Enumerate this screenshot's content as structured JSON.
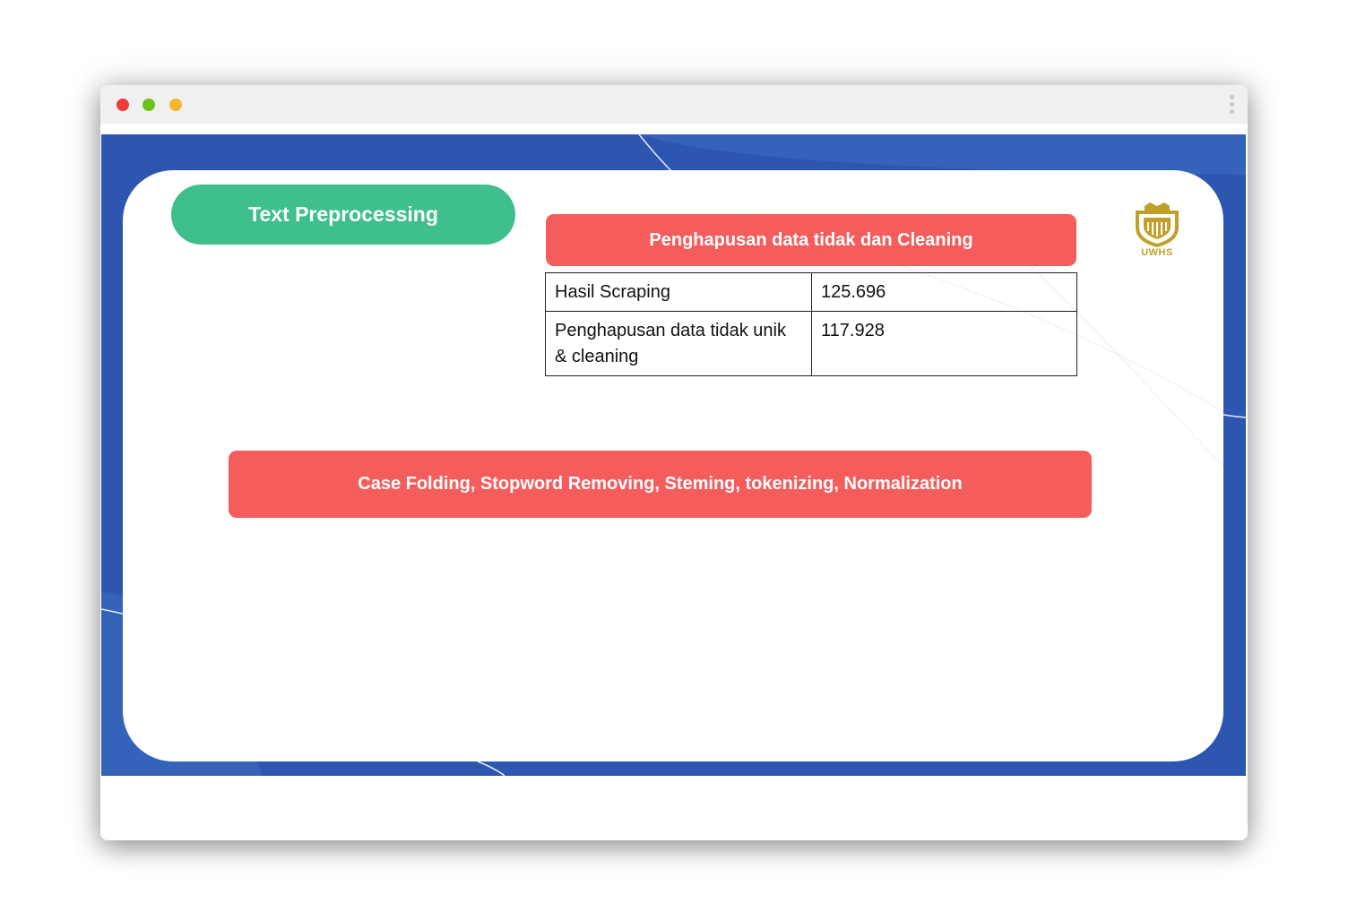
{
  "slide": {
    "title": "Text Preprocessing",
    "section_banner": "Penghapusan data tidak  dan Cleaning",
    "table": {
      "rows": [
        {
          "label": "Hasil Scraping",
          "value": "125.696"
        },
        {
          "label": "Penghapusan data tidak unik & cleaning",
          "value": "117.928"
        }
      ]
    },
    "steps_banner": "Case Folding, Stopword Removing, Steming, tokenizing, Normalization",
    "logo_text": "UWHS"
  },
  "colors": {
    "slide_background": "#2c56b0",
    "title_pill": "#3fbf8b",
    "banner": "#f55d5d",
    "logo": "#c0a02a"
  }
}
